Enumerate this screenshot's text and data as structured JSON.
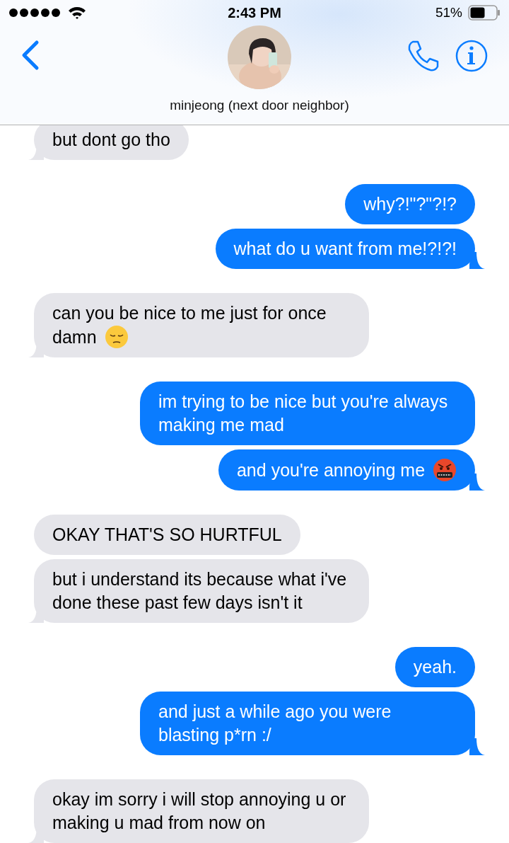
{
  "status_bar": {
    "time": "2:43 PM",
    "battery_percent": "51%"
  },
  "header": {
    "contact_name": "minjeong (next door neighbor)"
  },
  "messages": [
    {
      "kind": "received",
      "text": "but dont go tho"
    },
    {
      "kind": "sent",
      "text": "why?!\"?\"?!?"
    },
    {
      "kind": "sent",
      "text": "what do u want from me!?!?!"
    },
    {
      "kind": "received",
      "text": "can you be nice to me just for once damn",
      "emoji": {
        "kind": "pensive"
      }
    },
    {
      "kind": "sent",
      "text": "im trying to be nice but you're always making me mad"
    },
    {
      "kind": "sent",
      "text": "and you're annoying me",
      "emoji": {
        "kind": "cursing"
      }
    },
    {
      "kind": "received",
      "text": "OKAY THAT'S SO HURTFUL"
    },
    {
      "kind": "received",
      "text": "but i understand its because what i've done these past few days isn't it"
    },
    {
      "kind": "sent",
      "text": "yeah."
    },
    {
      "kind": "sent",
      "text": "and just a while ago you were blasting p*rn :/"
    },
    {
      "kind": "received",
      "text": "okay im sorry i will stop annoying u or making u mad from now on"
    }
  ]
}
